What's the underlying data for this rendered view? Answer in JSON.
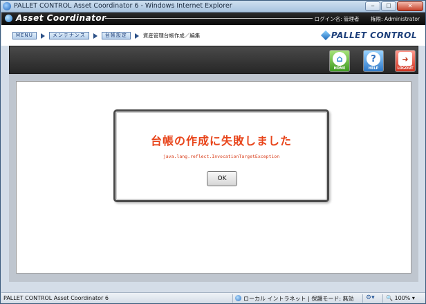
{
  "window": {
    "title": "PALLET CONTROL Asset Coordinator 6 - Windows Internet Explorer",
    "buttons": {
      "minimize": "▭",
      "maximize": "▭",
      "close": "✕"
    }
  },
  "header": {
    "app_name": "Asset Coordinator",
    "login_label": "ログイン名: 管理者",
    "role_label": "権限: Administrator"
  },
  "breadcrumb": {
    "items": [
      {
        "label": "MENU"
      },
      {
        "label": "メンテナンス"
      },
      {
        "label": "台帳設定"
      }
    ],
    "current": "資産管理台帳作成／編集"
  },
  "brand": {
    "name": "PALLET CONTROL"
  },
  "toolbar": {
    "home_label": "HOME",
    "help_label": "HELP",
    "logout_label": "LOGOUT",
    "home_icon": "home-icon",
    "help_icon": "help-icon",
    "logout_icon": "logout-icon"
  },
  "dialog": {
    "title": "台帳の作成に失敗しました",
    "detail": "java.lang.reflect.InvocationTargetException",
    "ok_label": "OK",
    "accent_color": "#e8451b"
  },
  "statusbar": {
    "text": "PALLET CONTROL Asset Coordinator 6",
    "zone": "ローカル イントラネット | 保護モード: 無効",
    "zoom": "100%"
  }
}
